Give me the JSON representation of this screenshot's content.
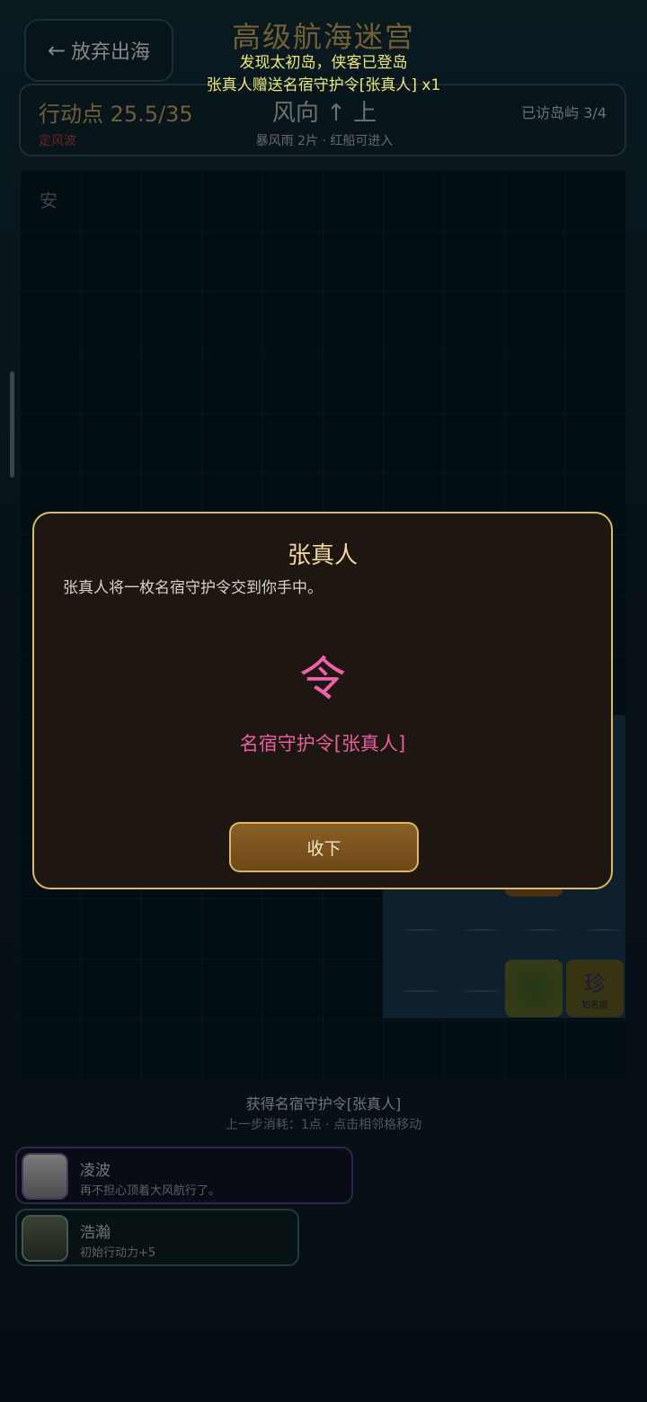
{
  "header": {
    "quit_arrow": "←",
    "quit_label": "放弃出海",
    "title": "高级航海迷宫"
  },
  "toasts": [
    "发现太初岛，侠客已登岛",
    "张真人赠送名宿守护令[张真人] x1"
  ],
  "status": {
    "action_points": "行动点 25.5/35",
    "ap_effect": "定风波",
    "wind": "风向 ↑ 上",
    "weather": "暴风雨 2片 · 红船可进入",
    "visited": "已访岛屿 3/4"
  },
  "grid": {
    "safe_cell_label": "安",
    "treasure_char": "珍",
    "treasure_label": "知名度"
  },
  "log": {
    "line1": "获得名宿守护令[张真人]",
    "line2": "上一步消耗：1点 · 点击相邻格移动"
  },
  "buffs": [
    {
      "name": "凌波",
      "desc": "再不担心顶着大风航行了。"
    },
    {
      "name": "浩瀚",
      "desc": "初始行动力+5"
    }
  ],
  "modal": {
    "title": "张真人",
    "text": "张真人将一枚名宿守护令交到你手中。",
    "reward_glyph": "令",
    "reward_name": "名宿守护令[张真人]",
    "accept_label": "收下"
  },
  "colors": {
    "accent_gold": "#d8ba6c",
    "reward_pink": "#e85ea0",
    "toast_yellow": "#ece77a"
  }
}
